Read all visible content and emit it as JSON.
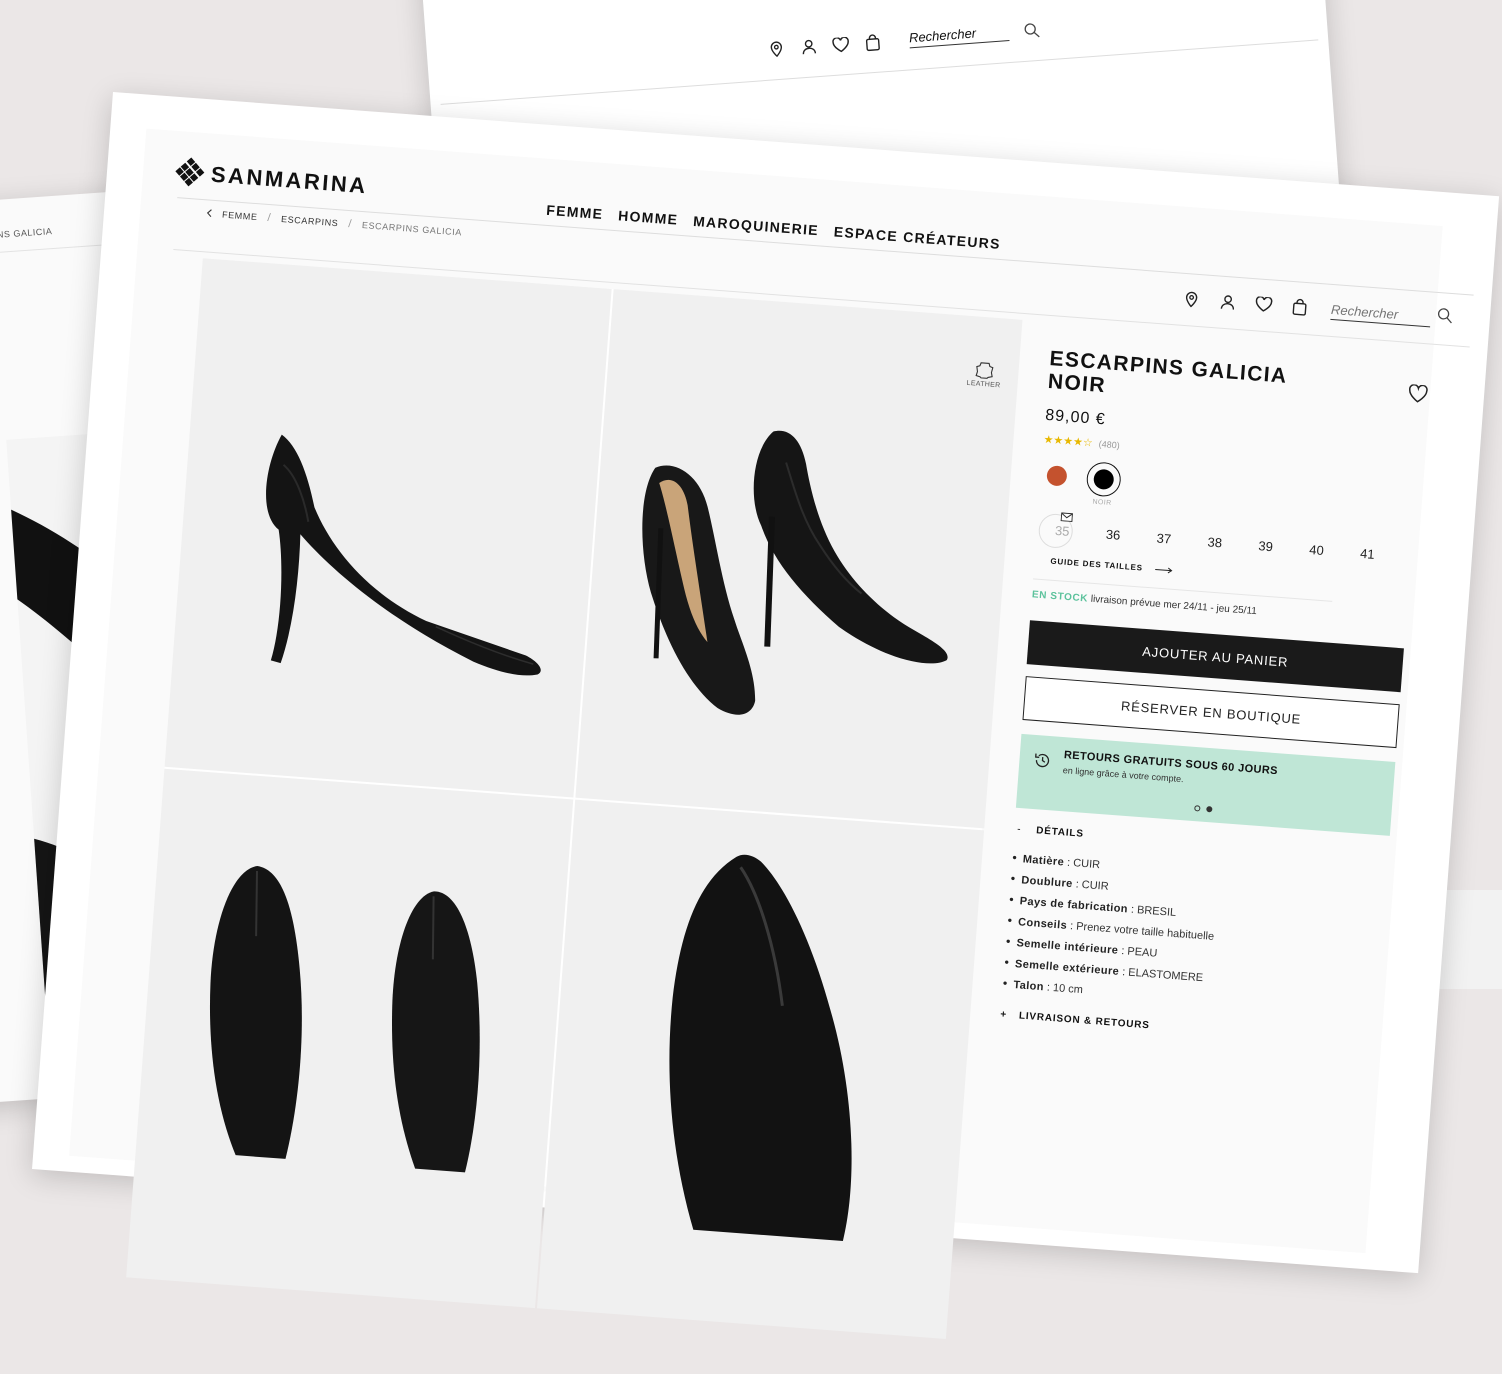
{
  "brand": {
    "name": "SANMARINA"
  },
  "nav": {
    "items": [
      "FEMME",
      "HOMME",
      "MAROQUINERIE",
      "ESPACE CRÉATEURS"
    ]
  },
  "breadcrumb": {
    "items": [
      "FEMME",
      "ESCARPINS",
      "ESCARPINS GALICIA"
    ],
    "separator": "/"
  },
  "back_sheet_breadcrumb": "NS GALICIA",
  "search": {
    "placeholder": "Rechercher"
  },
  "header_icons": [
    "store-locator-icon",
    "account-icon",
    "wishlist-icon",
    "bag-icon",
    "search-icon"
  ],
  "gallery": {
    "badge_label": "LEATHER"
  },
  "product": {
    "title": "ESCARPINS GALICIA NOIR",
    "price": "89,00 €",
    "rating_stars": 4.5,
    "rating_count": "(480)",
    "colors": [
      {
        "name": "",
        "hex": "#c4522e",
        "selected": false
      },
      {
        "name": "NOIR",
        "hex": "#000000",
        "selected": true
      }
    ],
    "sizes": [
      "35",
      "36",
      "37",
      "38",
      "39",
      "40",
      "41"
    ],
    "unavailable_sizes": [
      "35"
    ],
    "size_guide_label": "GUIDE DES TAILLES",
    "stock_label": "EN STOCK",
    "delivery_label": "livraison prévue",
    "delivery_dates": "mer 24/11 - jeu 25/11",
    "add_to_cart_label": "AJOUTER AU PANIER",
    "reserve_label": "RÉSERVER EN BOUTIQUE",
    "returns": {
      "title": "RETOURS GRATUITS SOUS 60 JOURS",
      "subtitle": "en ligne grâce à votre compte.",
      "color": "#bfe6d6"
    },
    "details": {
      "heading": "DÉTAILS",
      "toggle": "-",
      "items": [
        {
          "key": "Matière",
          "value": "CUIR"
        },
        {
          "key": "Doublure",
          "value": "CUIR"
        },
        {
          "key": "Pays de fabrication",
          "value": "BRESIL"
        },
        {
          "key": "Conseils",
          "value": "Prenez votre taille habituelle"
        },
        {
          "key": "Semelle intérieure",
          "value": "PEAU"
        },
        {
          "key": "Semelle extérieure",
          "value": "ELASTOMERE"
        },
        {
          "key": "Talon",
          "value": "10 cm"
        }
      ]
    },
    "delivery_section": {
      "heading": "LIVRAISON & RETOURS",
      "toggle": "+"
    }
  },
  "colors": {
    "stock_green": "#5cc29c",
    "dark_button": "#1a1a1a",
    "background": "#ebe7e7"
  }
}
